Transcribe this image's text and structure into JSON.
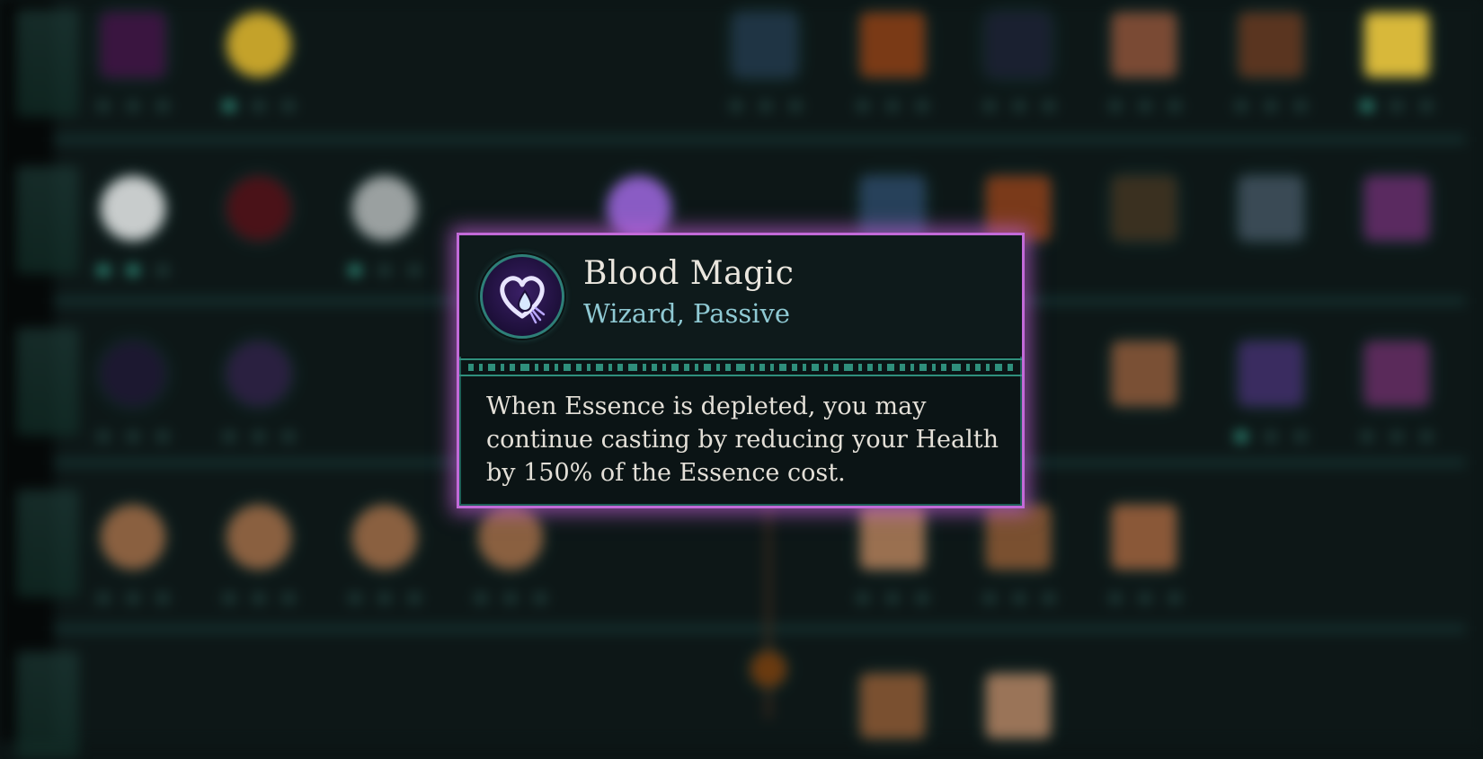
{
  "background": {
    "description_visible": false,
    "node_colors": [
      "#3a1540",
      "#c4a22a",
      "#1f3444",
      "#7a3a16",
      "#1a2030",
      "#7a4a34",
      "#5a3520",
      "#d8b83a",
      "#c8cccc",
      "#4a1218",
      "#9aa0a0",
      "#8a5cc4",
      "#27415a",
      "#7a3a1a",
      "#3a3020",
      "#3a4a55",
      "#5a2a60",
      "#1c1830",
      "#2a2040",
      "#6a1a1a",
      "#7a5035",
      "#3a2c60",
      "#5a2a5a",
      "#8a6040",
      "#8a6040",
      "#8a6040",
      "#8a6040",
      "#9a7050",
      "#7a5030",
      "#8a5838"
    ],
    "accent": "#2f8f7c"
  },
  "tooltip": {
    "name": "Blood Magic",
    "type": "Wizard, Passive",
    "description": "When Essence is depleted, you may continue casting by reducing your Health by 150% of the Essence cost.",
    "icon": "heart-drop-icon",
    "border_color": "#c26ad8",
    "type_color": "#8fc9d3"
  }
}
